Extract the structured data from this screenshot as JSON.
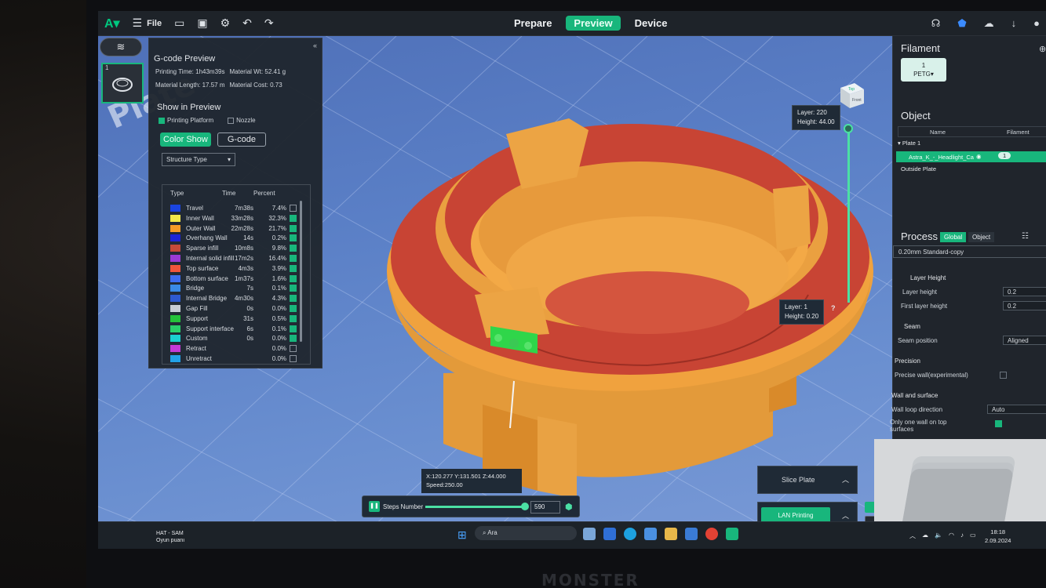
{
  "topbar": {
    "file_label": "File",
    "tabs": [
      {
        "label": "Prepare",
        "active": false
      },
      {
        "label": "Preview",
        "active": true
      },
      {
        "label": "Device",
        "active": false
      }
    ],
    "accent_color": "#18b67c"
  },
  "plate": {
    "thumb_number": "1",
    "watermark": "Plate"
  },
  "gcode_preview": {
    "title": "G-code Preview",
    "printing_time": "Printing Time: 1h43m39s",
    "material_wt": "Material Wt: 52.41 g",
    "material_length": "Material Length: 17.57 m",
    "material_cost": "Material Cost: 0.73",
    "show_in_preview": "Show in Preview",
    "printing_platform": "Printing Platform",
    "nozzle": "Nozzle",
    "color_show_btn": "Color Show",
    "gcode_btn": "G-code",
    "structure_select": "Structure Type",
    "legend_headers": {
      "type": "Type",
      "time": "Time",
      "percent": "Percent"
    },
    "legend": [
      {
        "type": "Travel",
        "time": "7m38s",
        "percent": "7.4%",
        "color": "#1a44e0",
        "checked": false
      },
      {
        "type": "Inner Wall",
        "time": "33m28s",
        "percent": "32.3%",
        "color": "#f2e84a",
        "checked": true
      },
      {
        "type": "Outer Wall",
        "time": "22m28s",
        "percent": "21.7%",
        "color": "#f59b26",
        "checked": true
      },
      {
        "type": "Overhang Wall",
        "time": "14s",
        "percent": "0.2%",
        "color": "#1c24d6",
        "checked": true
      },
      {
        "type": "Sparse infill",
        "time": "10m8s",
        "percent": "9.8%",
        "color": "#c44a3a",
        "checked": true
      },
      {
        "type": "Internal solid infill",
        "time": "17m2s",
        "percent": "16.4%",
        "color": "#9a3ad6",
        "checked": true
      },
      {
        "type": "Top surface",
        "time": "4m3s",
        "percent": "3.9%",
        "color": "#f0553c",
        "checked": true
      },
      {
        "type": "Bottom surface",
        "time": "1m37s",
        "percent": "1.6%",
        "color": "#3d6cf0",
        "checked": true
      },
      {
        "type": "Bridge",
        "time": "7s",
        "percent": "0.1%",
        "color": "#3a8ae6",
        "checked": true
      },
      {
        "type": "Internal Bridge",
        "time": "4m30s",
        "percent": "4.3%",
        "color": "#2e5ad0",
        "checked": true
      },
      {
        "type": "Gap Fill",
        "time": "0s",
        "percent": "0.0%",
        "color": "#c8ccd4",
        "checked": true
      },
      {
        "type": "Support",
        "time": "31s",
        "percent": "0.5%",
        "color": "#25c23a",
        "checked": true
      },
      {
        "type": "Support interface",
        "time": "6s",
        "percent": "0.1%",
        "color": "#2ad06a",
        "checked": true
      },
      {
        "type": "Custom",
        "time": "0s",
        "percent": "0.0%",
        "color": "#1ad0d0",
        "checked": true
      },
      {
        "type": "Retract",
        "time": "",
        "percent": "0.0%",
        "color": "#c43ad6",
        "checked": false
      },
      {
        "type": "Unretract",
        "time": "",
        "percent": "0.0%",
        "color": "#22a2e8",
        "checked": false
      }
    ]
  },
  "viewport": {
    "cube_top": "Top",
    "cube_front": "Front",
    "layer_top": "Layer: 220",
    "height_top": "Height: 44.00",
    "layer_bottom": "Layer: 1",
    "height_bottom": "Height: 0.20",
    "coords": "X:120.277  Y:131.501  Z:44.000",
    "speed": "Speed:250.00",
    "steps_label": "Steps Number",
    "steps_value": "590",
    "slice_plate": "Slice Plate",
    "lan_printing": "LAN Printing"
  },
  "right_panel": {
    "filament_title": "Filament",
    "filament_slot": "1",
    "filament_type": "PETG",
    "object_title": "Object",
    "col_name": "Name",
    "col_filament": "Filament",
    "plate_row": "Plate 1",
    "object_name": "Astra_K_-_Headlight_Ca",
    "object_filament": "1",
    "outside_plate": "Outside Plate",
    "process_title": "Process",
    "global_btn": "Global",
    "object_btn": "Object",
    "preset": "0.20mm Standard-copy",
    "layer_height_section": "Layer Height",
    "layer_height_label": "Layer height",
    "layer_height_value": "0.2",
    "first_layer_label": "First layer height",
    "first_layer_value": "0.2",
    "seam_section": "Seam",
    "seam_position_label": "Seam position",
    "seam_position_value": "Aligned",
    "precision_section": "Precision",
    "precise_wall_label": "Precise wall(experimental)",
    "wall_surface_section": "Wall and surface",
    "wall_loop_label": "Wall loop direction",
    "wall_loop_value": "Auto",
    "one_wall_label": "Only one wall on top surfaces"
  },
  "taskbar": {
    "news_title": "HAT - SAM",
    "news_sub": "Oyun puanı",
    "search_placeholder": "Ara",
    "time": "18:18",
    "date": "2.09.2024"
  },
  "bezel_brand": "MONSTER"
}
